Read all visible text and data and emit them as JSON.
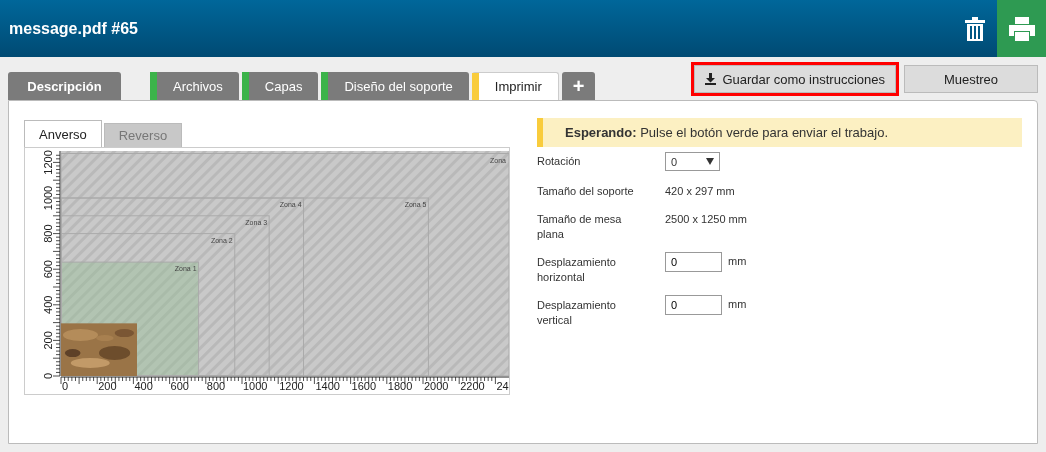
{
  "header": {
    "title": "message.pdf #65"
  },
  "tabs": [
    {
      "label": "Descripción",
      "selected": false
    },
    {
      "label": "Archivos",
      "selected": false,
      "color": "#3cb34a"
    },
    {
      "label": "Capas",
      "selected": false,
      "color": "#3cb34a"
    },
    {
      "label": "Diseño del soporte",
      "selected": false,
      "color": "#3cb34a"
    },
    {
      "label": "Imprimir",
      "selected": true,
      "color": "#f9cc3c"
    },
    {
      "label": "+",
      "selected": false
    }
  ],
  "actions": [
    {
      "label": "Guardar como instrucciones",
      "highlighted": true,
      "kind": "download"
    },
    {
      "label": "Muestreo",
      "highlighted": false,
      "kind": "plain"
    }
  ],
  "side_tabs": [
    {
      "label": "Anverso",
      "selected": true
    },
    {
      "label": "Reverso",
      "selected": false
    }
  ],
  "preview": {
    "x_ticks": [
      "0",
      "200",
      "400",
      "600",
      "800",
      "1000",
      "1200",
      "1400",
      "1600",
      "1800",
      "2000",
      "2200",
      "24"
    ],
    "y_ticks": [
      "0",
      "200",
      "400",
      "600",
      "800",
      "1000",
      "1200"
    ],
    "zones": [
      {
        "label": "Zona 1"
      },
      {
        "label": "Zona 2"
      },
      {
        "label": "Zona 3"
      },
      {
        "label": "Zona 4"
      },
      {
        "label": "Zona 5"
      },
      {
        "label": "Zona"
      }
    ]
  },
  "status": {
    "text": "**Esperando:** Pulse el botón verde para enviar el trabajo."
  },
  "form": [
    {
      "kind": "select",
      "label": "Rotación",
      "value": "0"
    },
    {
      "kind": "text",
      "label": "Tamaño del soporte",
      "value": "420 x 297 mm"
    },
    {
      "kind": "text",
      "label": "Tamaño de mesa plana",
      "value": "2500 x 1250 mm"
    },
    {
      "kind": "input",
      "label": "Desplazamiento horizontal",
      "value": "0",
      "unit": "mm"
    },
    {
      "kind": "input",
      "label": "Desplazamiento vertical",
      "value": "0",
      "unit": "mm"
    }
  ]
}
